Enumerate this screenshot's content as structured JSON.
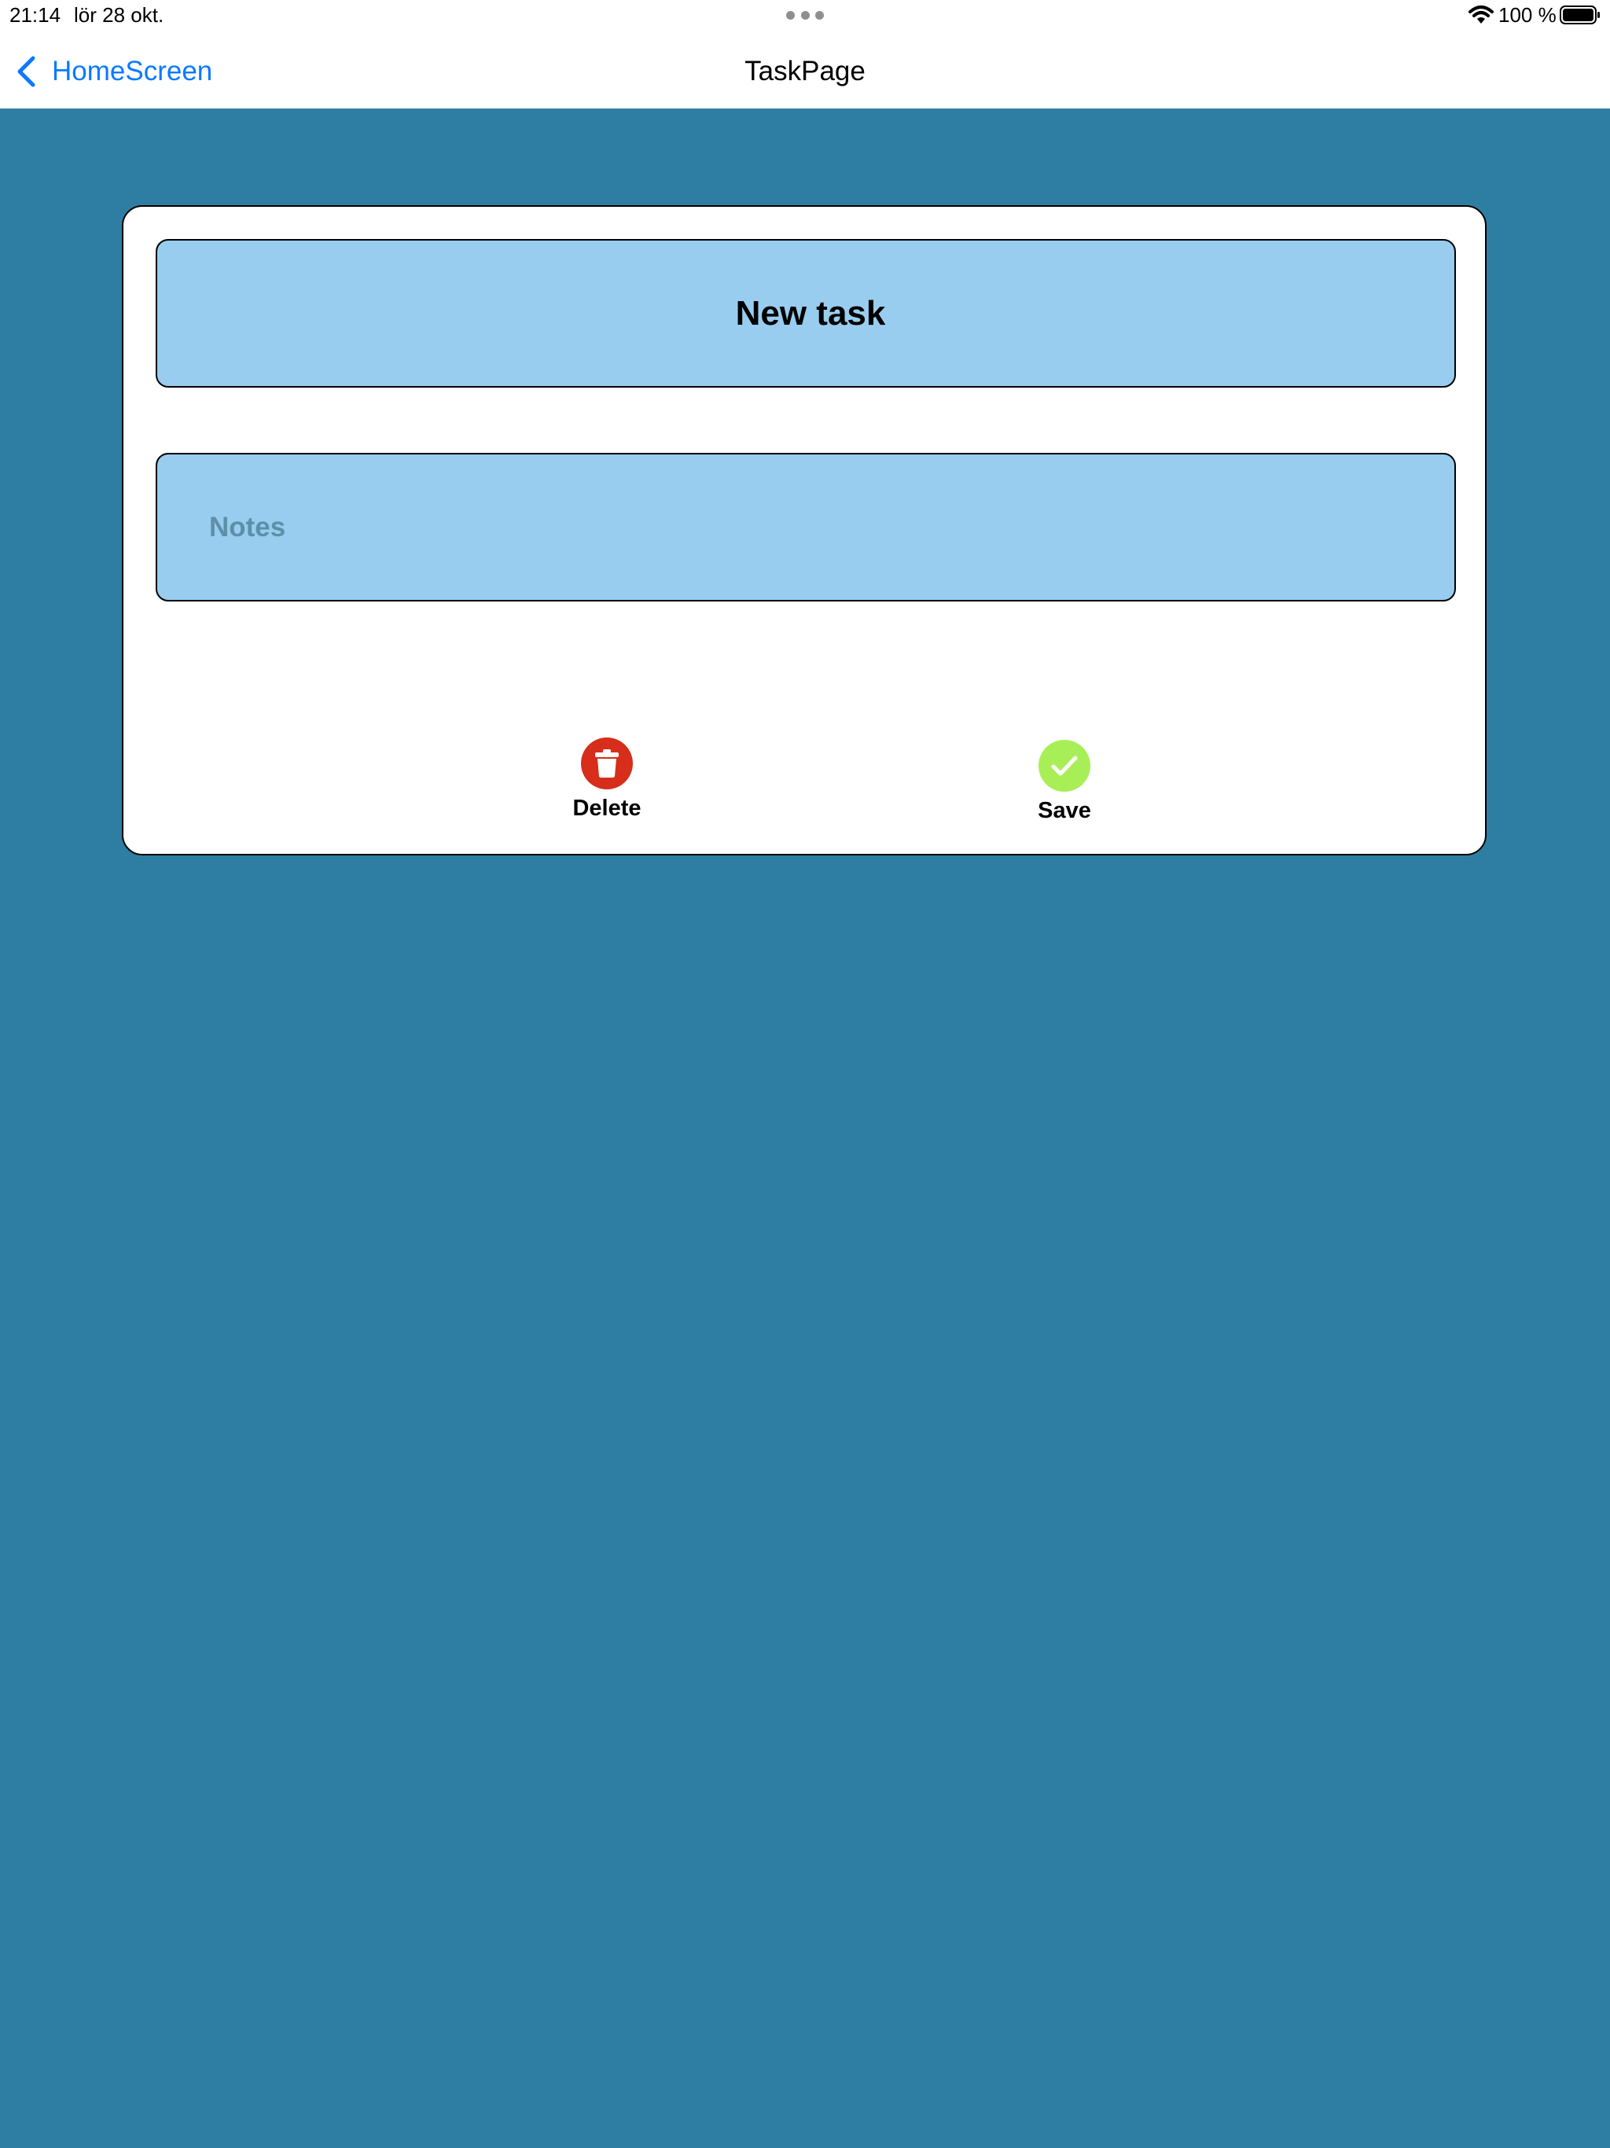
{
  "status_bar": {
    "time": "21:14",
    "date": "lör 28 okt.",
    "battery_percent": "100 %"
  },
  "nav": {
    "back_label": "HomeScreen",
    "title": "TaskPage"
  },
  "form": {
    "title_value": "New task",
    "notes_placeholder": "Notes"
  },
  "actions": {
    "delete_label": "Delete",
    "save_label": "Save"
  },
  "colors": {
    "background": "#2e7ea3",
    "field_fill": "#98cdef",
    "link_blue": "#0a7aff",
    "delete_red": "#d62e1b",
    "save_green": "#a8ef57"
  },
  "icons": {
    "back": "chevron-left-icon",
    "wifi": "wifi-icon",
    "battery": "battery-icon",
    "delete": "trash-icon",
    "save": "checkmark-icon"
  }
}
